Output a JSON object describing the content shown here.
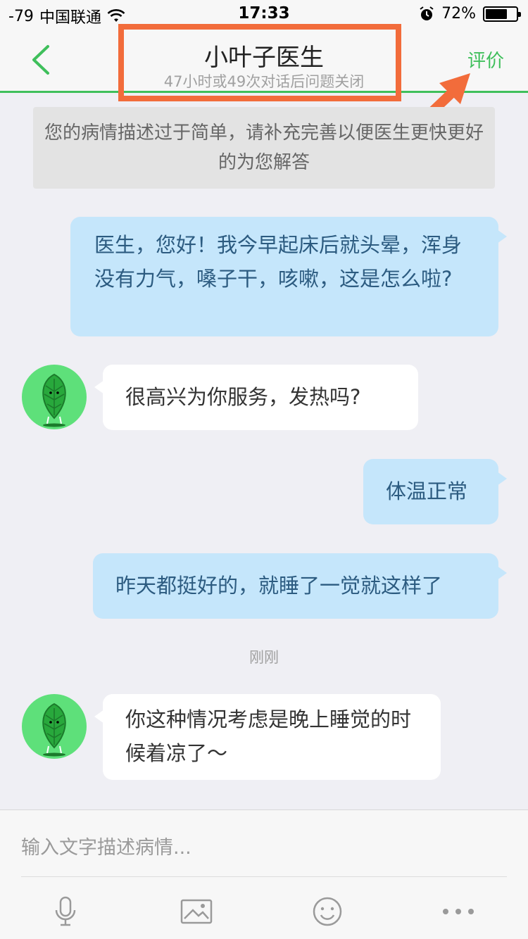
{
  "status_bar": {
    "signal": "-79",
    "carrier": "中国联通",
    "time": "17:33",
    "battery_percent": "72%",
    "battery_level": 0.72
  },
  "nav": {
    "title": "小叶子医生",
    "subtitle": "47小时或49次对话后问题关闭",
    "rate_label": "评价"
  },
  "notice": "您的病情描述过于简单，请补充完善以便医生更快更好的为您解答",
  "messages": [
    {
      "from": "user",
      "text": "医生，您好！我今早起床后就头晕，浑身没有力气，嗓子干，咳嗽，这是怎么啦?"
    },
    {
      "from": "doctor",
      "text": "很高兴为你服务，发热吗?"
    },
    {
      "from": "user",
      "text": "体温正常"
    },
    {
      "from": "user",
      "text": "昨天都挺好的，就睡了一觉就这样了"
    },
    {
      "from": "doctor",
      "text": "你这种情况考虑是晚上睡觉的时候着凉了～"
    }
  ],
  "timestamp": "刚刚",
  "input": {
    "placeholder": "输入文字描述病情...",
    "value": ""
  },
  "toolbar": [
    "microphone-icon",
    "image-icon",
    "emoji-icon",
    "more-icon"
  ],
  "colors": {
    "accent": "#3fbf5b",
    "annotation": "#f26c3b",
    "user_bubble": "#c5e6fb",
    "user_text": "#2c5b80"
  }
}
